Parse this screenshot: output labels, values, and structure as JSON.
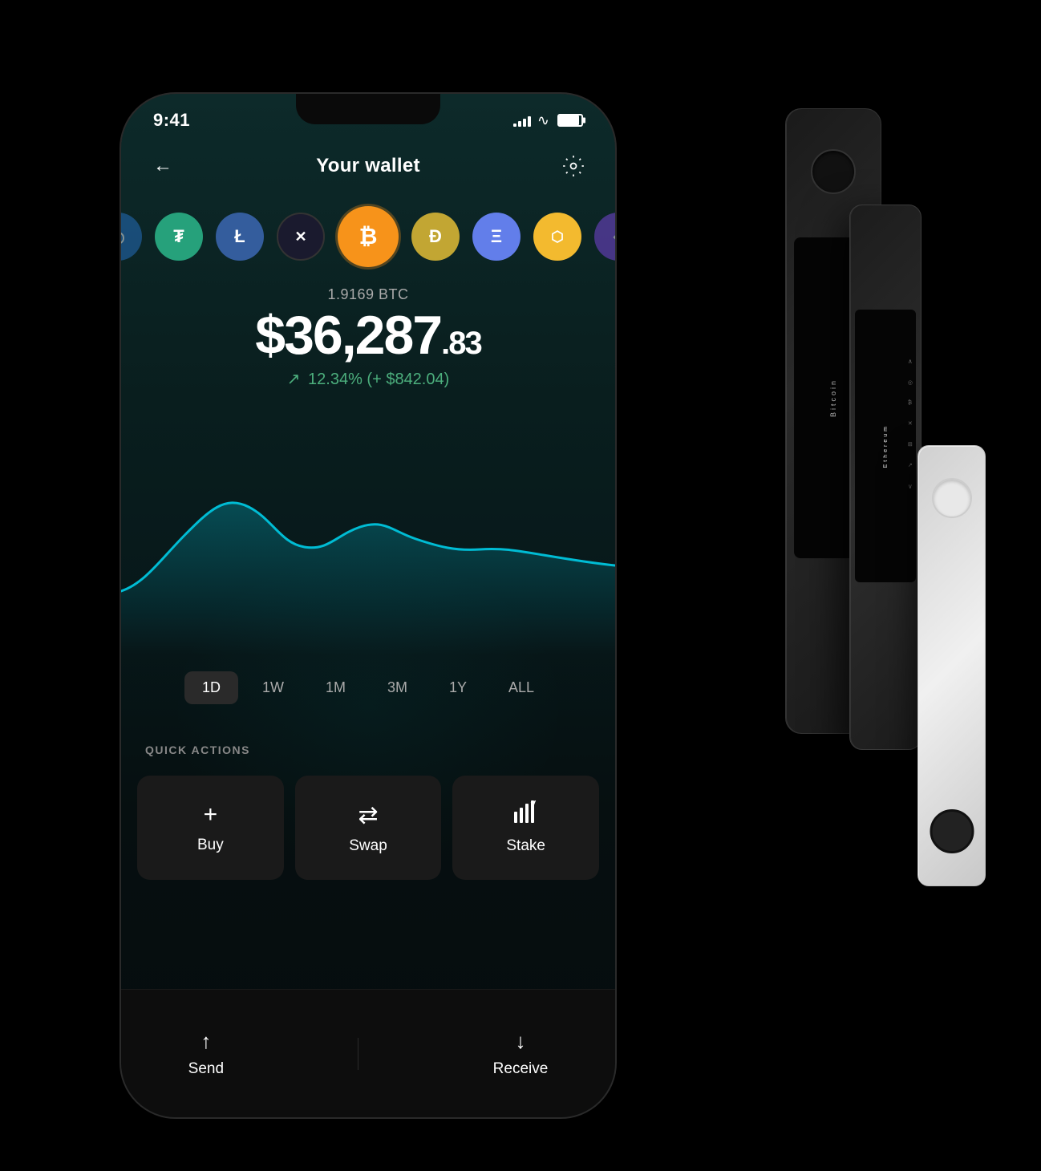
{
  "app": {
    "title": "Your wallet",
    "back_label": "←",
    "settings_label": "⚙"
  },
  "status_bar": {
    "time": "9:41",
    "signal_bars": [
      4,
      7,
      10,
      13,
      16
    ],
    "wifi": "wifi",
    "battery": "battery"
  },
  "crypto_row": {
    "coins": [
      {
        "symbol": "◎",
        "bg": "#2775ca",
        "label": "partial-left"
      },
      {
        "symbol": "₮",
        "bg": "#26a17b",
        "label": "USDT"
      },
      {
        "symbol": "Ł",
        "bg": "#345d9d",
        "label": "LTC"
      },
      {
        "symbol": "✕",
        "bg": "#000080",
        "label": "XRP"
      },
      {
        "symbol": "₿",
        "bg": "#f7931a",
        "label": "BTC",
        "active": true
      },
      {
        "symbol": "Ð",
        "bg": "#c2a633",
        "label": "DOGE"
      },
      {
        "symbol": "Ξ",
        "bg": "#627eea",
        "label": "ETH"
      },
      {
        "symbol": "⬡",
        "bg": "#f3ba2f",
        "label": "BNB"
      },
      {
        "symbol": "◈",
        "bg": "#8247e5",
        "label": "partial-right"
      }
    ]
  },
  "balance": {
    "btc_amount": "1.9169 BTC",
    "usd_main": "$36,287",
    "usd_cents": ".83",
    "change_pct": "12.34%",
    "change_usd": "+ $842.04",
    "change_display": "↗ 12.34% (+ $842.04)"
  },
  "chart": {
    "color": "#00bcd4",
    "time_filters": [
      "1D",
      "1W",
      "1M",
      "3M",
      "1Y",
      "ALL"
    ],
    "active_filter": "1D"
  },
  "quick_actions": {
    "label": "QUICK ACTIONS",
    "buttons": [
      {
        "icon": "+",
        "label": "Buy"
      },
      {
        "icon": "⇄",
        "label": "Swap"
      },
      {
        "icon": "↟",
        "label": "Stake"
      }
    ]
  },
  "bottom_bar": {
    "actions": [
      {
        "icon": "↑",
        "label": "Send"
      },
      {
        "icon": "↓",
        "label": "Receive"
      }
    ]
  },
  "ledger": {
    "bitcoin_label": "Bitcoin",
    "ethereum_label": "Ethereum"
  }
}
